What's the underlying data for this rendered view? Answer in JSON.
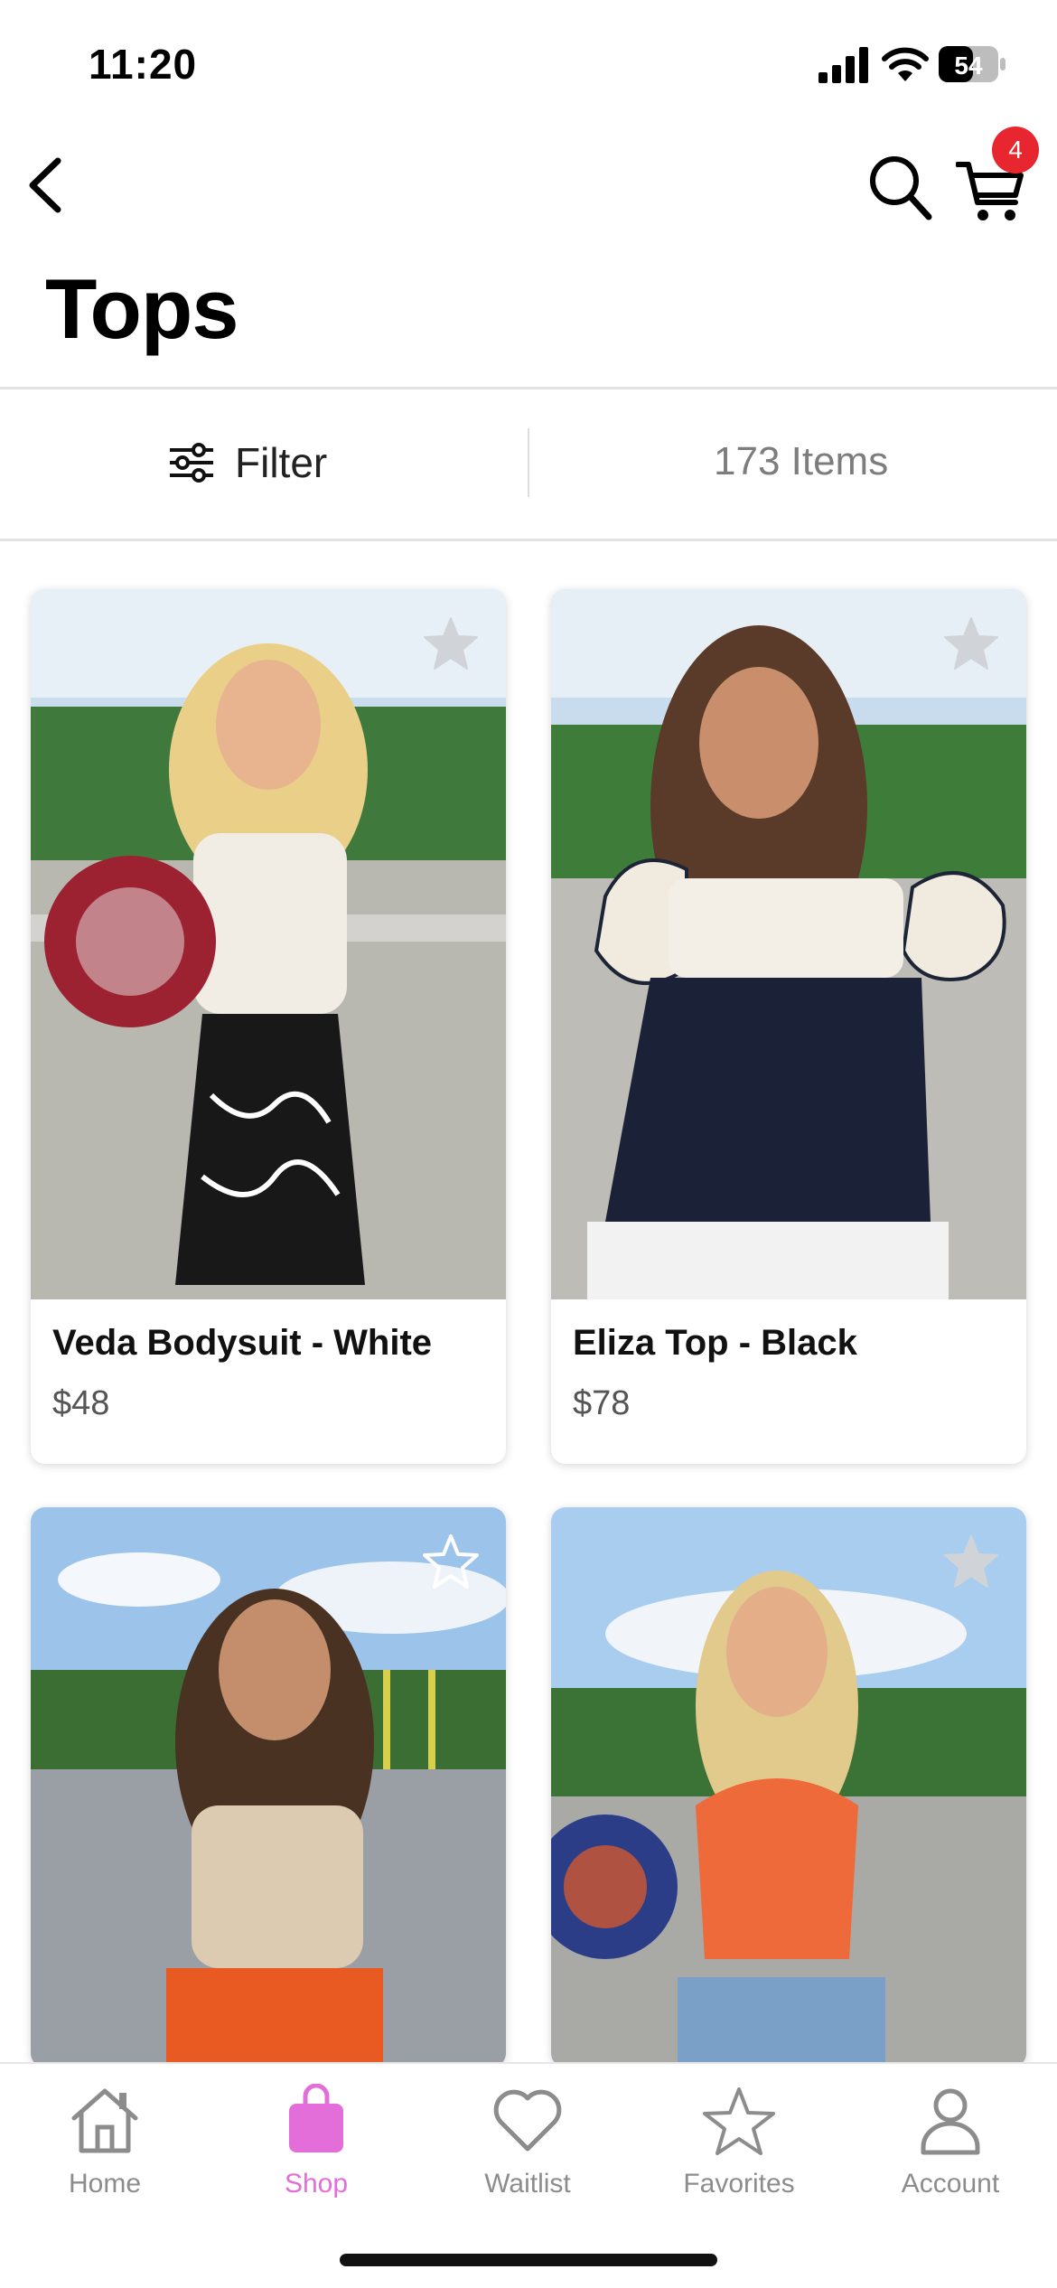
{
  "status_bar": {
    "time": "11:20",
    "battery": "54"
  },
  "header": {
    "title": "Tops",
    "cart_count": "4"
  },
  "toolbar": {
    "filter_label": "Filter",
    "item_count": "173 Items"
  },
  "products": [
    {
      "name": "Veda Bodysuit - White",
      "price": "$48",
      "favorited": false
    },
    {
      "name": "Eliza Top - Black",
      "price": "$78",
      "favorited": false
    },
    {
      "name": "",
      "price": "",
      "favorited": false
    },
    {
      "name": "",
      "price": "",
      "favorited": false
    }
  ],
  "tabs": [
    {
      "label": "Home",
      "icon": "home-icon",
      "active": false
    },
    {
      "label": "Shop",
      "icon": "shopping-bag-icon",
      "active": true
    },
    {
      "label": "Waitlist",
      "icon": "heart-icon",
      "active": false
    },
    {
      "label": "Favorites",
      "icon": "star-icon",
      "active": false
    },
    {
      "label": "Account",
      "icon": "user-icon",
      "active": false
    }
  ],
  "colors": {
    "accent": "#e36ed9",
    "badge": "#e8262f",
    "inactive_tab": "#8c8c8c"
  }
}
